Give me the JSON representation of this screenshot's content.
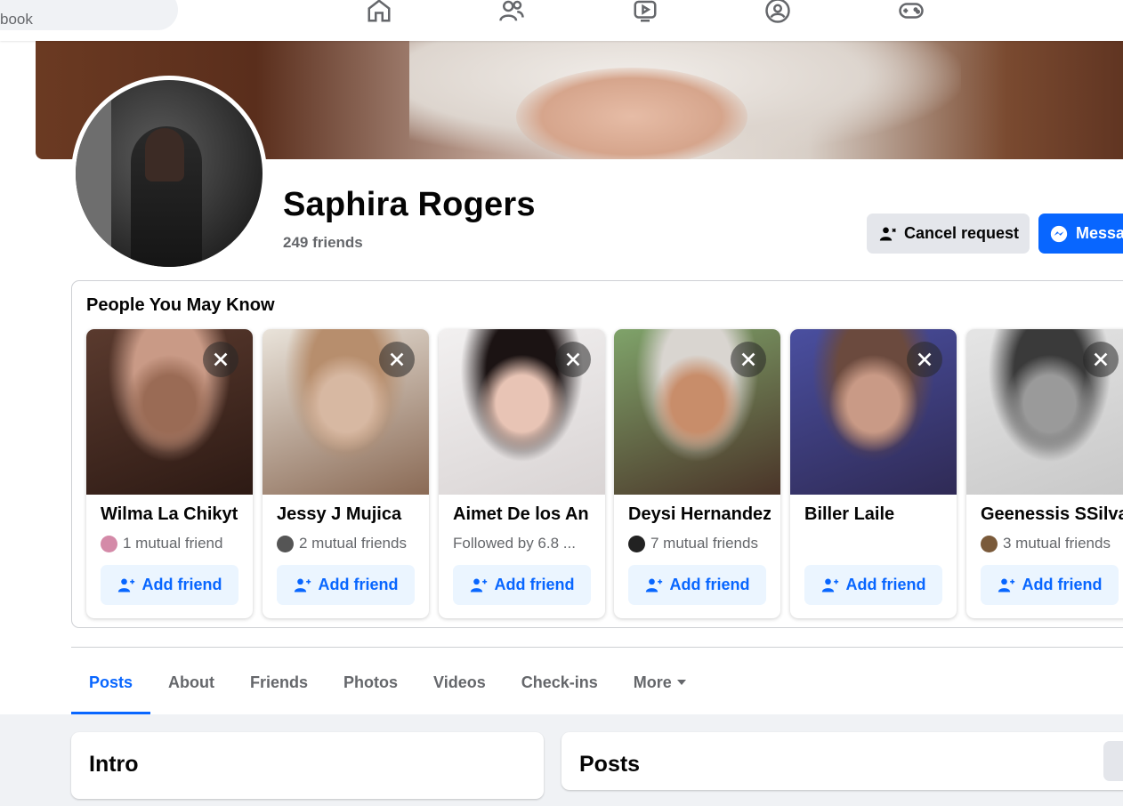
{
  "search": {
    "placeholder": "book"
  },
  "nav": [
    "home-icon",
    "friends-icon",
    "watch-icon",
    "groups-icon",
    "gaming-icon"
  ],
  "profile": {
    "name": "Saphira Rogers",
    "friends": "249 friends",
    "cancel_request": "Cancel request",
    "message": "Messa"
  },
  "pymk": {
    "title": "People You May Know",
    "add_label": "Add friend",
    "people": [
      {
        "name": "Wilma La Chikyt",
        "mutual": "1 mutual friend",
        "dot": "#d48aa8",
        "photo": [
          "#5a3a2e",
          "#9a6b55",
          "#c99a86",
          "#2d1a14"
        ]
      },
      {
        "name": "Jessy J Mujica",
        "mutual": "2 mutual friends",
        "dot": "#555555",
        "photo": [
          "#e9e3da",
          "#d7b8a2",
          "#b78e6d",
          "#8a6a55"
        ]
      },
      {
        "name": "Aimet De los An",
        "mutual": "Followed by 6.8 ...",
        "dot": "",
        "photo": [
          "#f2f0f0",
          "#e8c4b5",
          "#1b1313",
          "#d9d4d4"
        ]
      },
      {
        "name": "Deysi Hernandez",
        "mutual": "7 mutual friends",
        "dot": "#222222",
        "photo": [
          "#7fa36a",
          "#c88d6a",
          "#d9d5d0",
          "#4a3428"
        ]
      },
      {
        "name": "Biller Laile",
        "mutual": "",
        "dot": "",
        "photo": [
          "#4a4fa0",
          "#c99a86",
          "#6b4a3e",
          "#2f2a55"
        ]
      },
      {
        "name": "Geenessis SSilva",
        "mutual": "3 mutual friends",
        "dot": "#7a5a3a",
        "photo": [
          "#e5e5e5",
          "#9a9a9a",
          "#3a3a3a",
          "#c8c8c8"
        ]
      }
    ]
  },
  "tabs": [
    "Posts",
    "About",
    "Friends",
    "Photos",
    "Videos",
    "Check-ins",
    "More"
  ],
  "intro": {
    "title": "Intro"
  },
  "posts": {
    "title": "Posts"
  },
  "colors": {
    "accent": "#0866ff",
    "muted": "#65676b",
    "bg": "#f0f2f5"
  }
}
